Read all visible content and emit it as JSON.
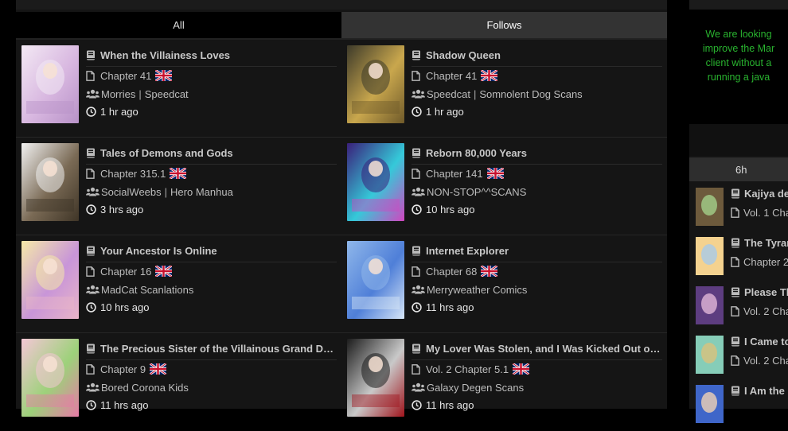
{
  "tabs": {
    "all": "All",
    "follows": "Follows"
  },
  "updates": [
    {
      "title": "When the Villainess Loves",
      "chapter": "Chapter 41",
      "groups": [
        "Morries",
        "Speedcat"
      ],
      "time": "1 hr ago",
      "flag": "uk-flag-icon"
    },
    {
      "title": "Shadow Queen",
      "chapter": "Chapter 41",
      "groups": [
        "Speedcat",
        "Somnolent Dog Scans"
      ],
      "time": "1 hr ago",
      "flag": "uk-flag-icon"
    },
    {
      "title": "Tales of Demons and Gods",
      "chapter": "Chapter 315.1",
      "groups": [
        "SocialWeebs",
        "Hero Manhua"
      ],
      "time": "3 hrs ago",
      "flag": "uk-flag-icon"
    },
    {
      "title": "Reborn 80,000 Years",
      "chapter": "Chapter 141",
      "groups": [
        "NON-STOP^^SCANS"
      ],
      "time": "10 hrs ago",
      "flag": "uk-flag-icon"
    },
    {
      "title": "Your Ancestor Is Online",
      "chapter": "Chapter 16",
      "groups": [
        "MadCat Scanlations"
      ],
      "time": "10 hrs ago",
      "flag": "uk-flag-icon"
    },
    {
      "title": "Internet Explorer",
      "chapter": "Chapter 68",
      "groups": [
        "Merryweather Comics"
      ],
      "time": "11 hrs ago",
      "flag": "uk-flag-icon"
    },
    {
      "title": "The Precious Sister of the Villainous Grand Duke",
      "chapter": "Chapter 9",
      "groups": [
        "Bored Corona Kids"
      ],
      "time": "11 hrs ago",
      "flag": "uk-flag-icon"
    },
    {
      "title": "My Lover Was Stolen, and I Was Kicked Out of t…",
      "chapter": "Vol. 2 Chapter 5.1",
      "groups": [
        "Galaxy Degen Scans"
      ],
      "time": "11 hrs ago",
      "flag": "uk-flag-icon"
    }
  ],
  "notice": {
    "lines": [
      "We are looking",
      "improve the Mar",
      "client without a",
      "running a java"
    ]
  },
  "sidebar": {
    "tab": "6h",
    "items": [
      {
        "title": "Kajiya de",
        "sub": "Vol. 1 Cha"
      },
      {
        "title": "The Tyran",
        "sub": "Chapter 2"
      },
      {
        "title": "Please Th",
        "sub": "Vol. 2 Cha"
      },
      {
        "title": "I Came to",
        "sub": "Vol. 2 Cha"
      },
      {
        "title": "I Am the",
        "sub": ""
      }
    ]
  },
  "colors": {
    "accent_green": "#29b32f",
    "panel": "#151515",
    "tab_active": "#333333"
  }
}
